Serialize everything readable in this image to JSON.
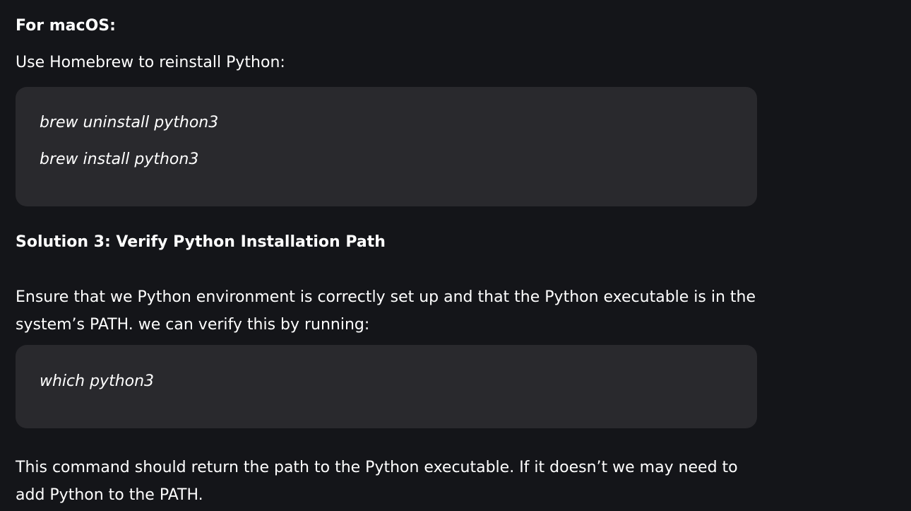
{
  "sections": {
    "macos_heading": "For macOS:",
    "homebrew_text": "Use Homebrew to reinstall Python:",
    "code_block_1": {
      "lines": [
        "brew uninstall python3",
        "brew install python3"
      ]
    },
    "solution3_heading": "Solution 3: Verify Python Installation Path",
    "ensure_text": "Ensure that we Python environment is correctly set up and that the Python executable is in the system’s PATH. we can verify this by running:",
    "code_block_2": {
      "lines": [
        "which python3"
      ]
    },
    "command_text": "This command should return the path to the Python executable. If it doesn’t we may need to add Python to the PATH."
  },
  "colors": {
    "background": "#141519",
    "code_background": "#29292d",
    "text": "#ffffff"
  }
}
